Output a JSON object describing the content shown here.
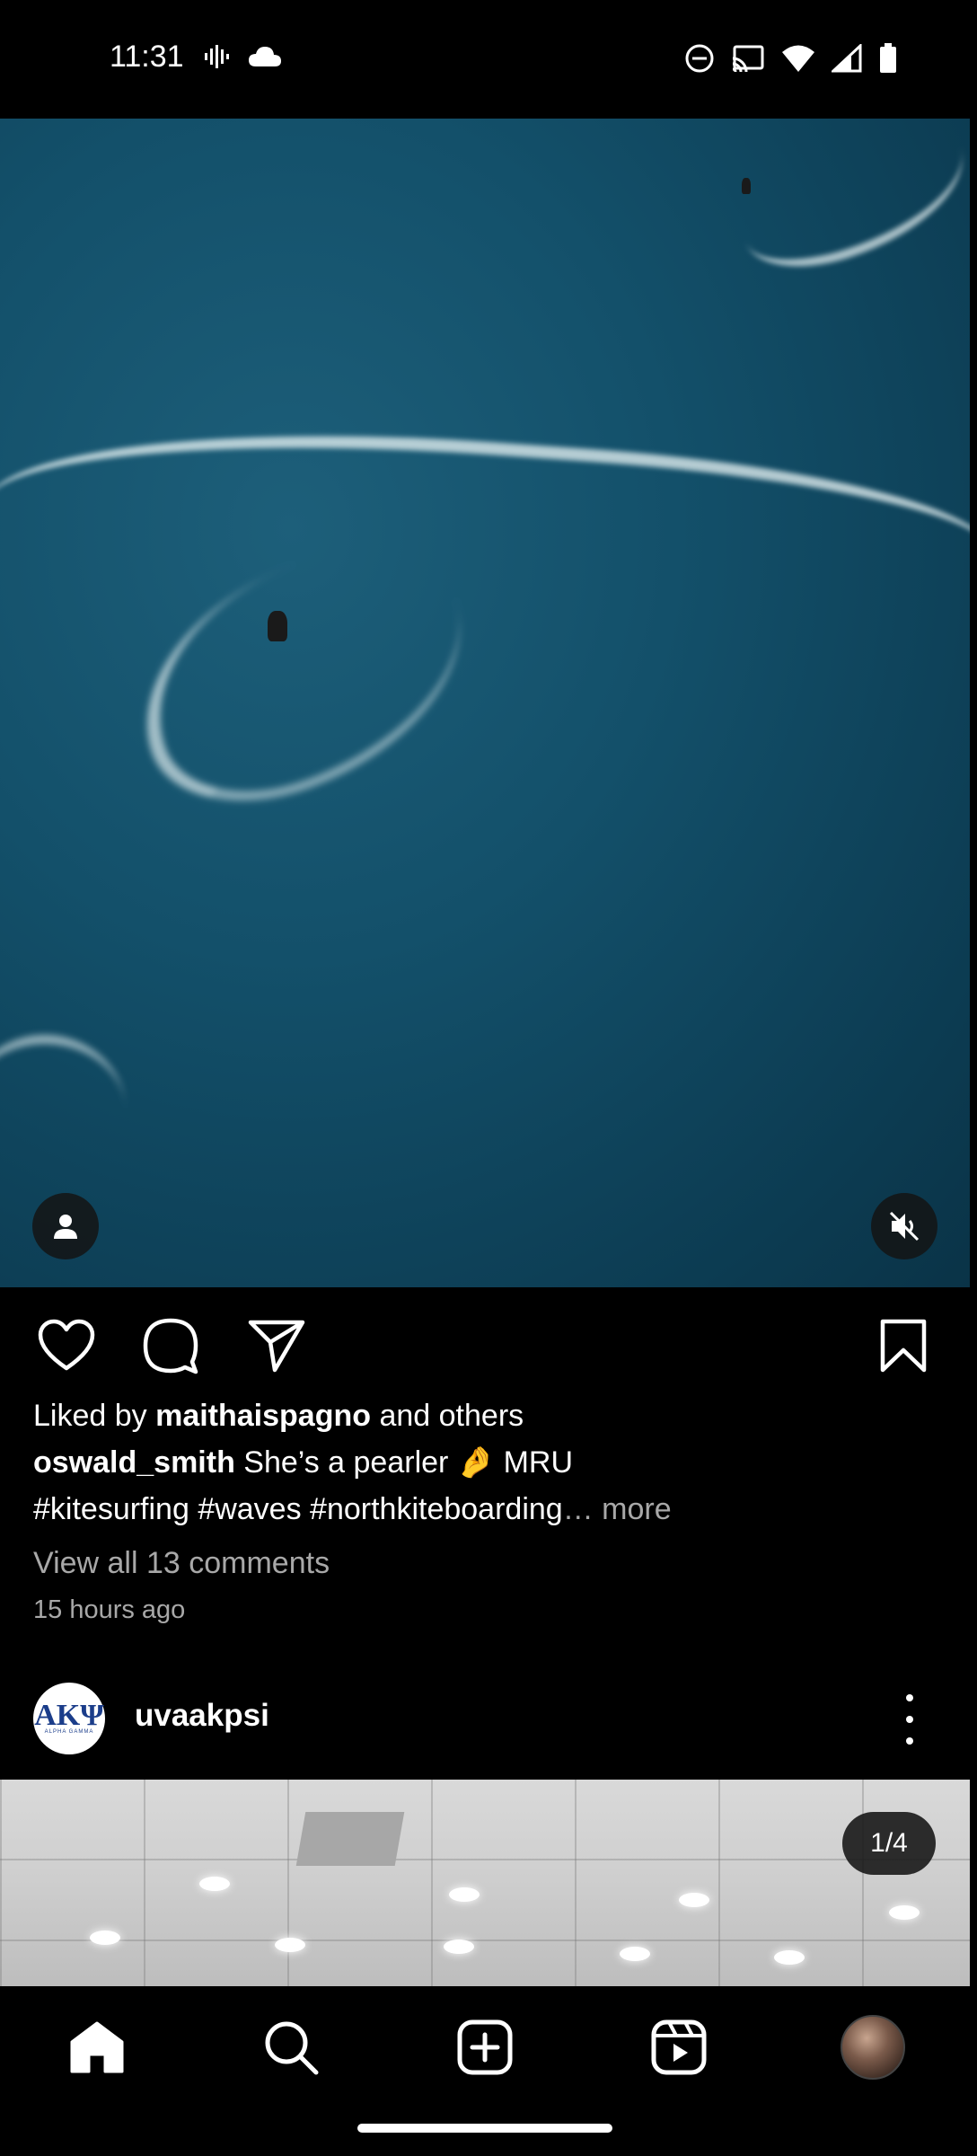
{
  "status_bar": {
    "time": "11:31"
  },
  "post1": {
    "liked_prefix": "Liked by ",
    "liked_user": "maithaispagno",
    "liked_suffix": " and others",
    "author": "oswald_smith",
    "caption_text": " She’s a pearler 🤌 MRU",
    "hashtags": "#kitesurfing #waves #northkiteboarding",
    "ellipsis": "…",
    "more_label": " more",
    "comments_link": "View all 13 comments",
    "timestamp": "15 hours ago"
  },
  "post2": {
    "username": "uvaakpsi",
    "avatar_letters": "AKΨ",
    "avatar_subtext": "ALPHA GAMMA",
    "media_counter": "1/4"
  },
  "icons": {
    "media_user_tag": "person-icon",
    "media_audio": "muted-speaker-icon",
    "like": "heart-icon",
    "comment": "comment-icon",
    "share": "paper-plane-icon",
    "save": "bookmark-icon",
    "nav_home": "home-icon",
    "nav_search": "search-icon",
    "nav_create": "plus-square-icon",
    "nav_reels": "reels-icon",
    "nav_profile": "profile-avatar"
  },
  "colors": {
    "background": "#000000",
    "text_primary": "#ffffff",
    "text_secondary": "#a8a8a8",
    "ocean": "#13506a"
  }
}
